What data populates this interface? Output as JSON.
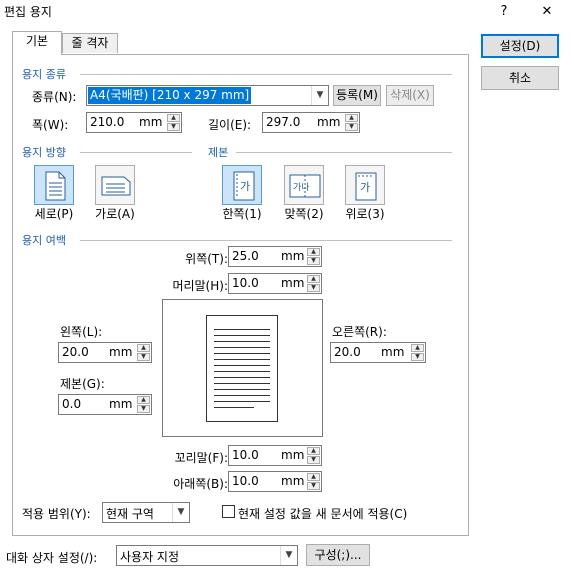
{
  "window": {
    "title": "편집 용지",
    "help_glyph": "?",
    "close_glyph": "✕"
  },
  "tabs": [
    {
      "label": "기본",
      "active": true
    },
    {
      "label": "줄 격자",
      "active": false
    }
  ],
  "buttons": {
    "ok": "설정(D)",
    "cancel": "취소"
  },
  "paper_type": {
    "section": "용지 종류",
    "kind_label": "종류(N):",
    "kind_value": "A4(국배판) [210 x 297 mm]",
    "register": "등록(M)",
    "delete": "삭제(X)",
    "width_label": "폭(W):",
    "width_value": "210.0",
    "length_label": "길이(E):",
    "length_value": "297.0",
    "unit": "mm"
  },
  "orientation": {
    "section": "용지 방향",
    "options": [
      {
        "label": "세로(P)",
        "selected": true,
        "icon": "portrait-page-icon"
      },
      {
        "label": "가로(A)",
        "selected": false,
        "icon": "landscape-page-icon"
      }
    ]
  },
  "binding": {
    "section": "제본",
    "options": [
      {
        "label": "한쪽(1)",
        "selected": true,
        "glyph": "가",
        "icon": "single-side-binding-icon"
      },
      {
        "label": "맞쪽(2)",
        "selected": false,
        "glyph": "가나",
        "icon": "facing-binding-icon"
      },
      {
        "label": "위로(3)",
        "selected": false,
        "glyph": "가",
        "icon": "top-binding-icon"
      }
    ]
  },
  "margins": {
    "section": "용지 여백",
    "top_label": "위쪽(T):",
    "top_value": "25.0",
    "header_label": "머리말(H):",
    "header_value": "10.0",
    "left_label": "왼쪽(L):",
    "left_value": "20.0",
    "gutter_label": "제본(G):",
    "gutter_value": "0.0",
    "right_label": "오른쪽(R):",
    "right_value": "20.0",
    "footer_label": "꼬리말(F):",
    "footer_value": "10.0",
    "bottom_label": "아래쪽(B):",
    "bottom_value": "10.0",
    "unit": "mm"
  },
  "apply": {
    "scope_label": "적용 범위(Y):",
    "scope_value": "현재 구역",
    "apply_new_label": "현재 설정 값을 새 문서에 적용(C)",
    "apply_new_checked": false
  },
  "dialog_settings": {
    "label": "대화 상자 설정(/):",
    "value": "사용자 지정",
    "configure": "구성(;)..."
  }
}
